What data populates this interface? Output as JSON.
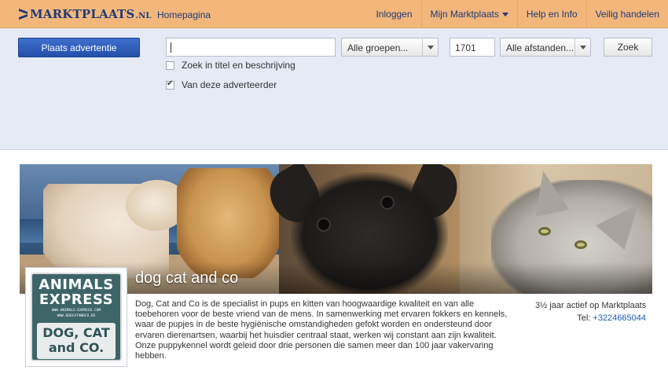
{
  "header": {
    "logo_text": "MARKTPLAATS",
    "logo_suffix": ".NL",
    "home_link": "Homepagina",
    "nav": [
      "Inloggen",
      "Mijn Marktplaats",
      "Help en Info",
      "Veilig handelen"
    ]
  },
  "search": {
    "place_ad": "Plaats advertentie",
    "query_value": "",
    "group_select": "Alle groepen...",
    "zipcode": "1701",
    "distance_select": "Alle afstanden...",
    "search_button": "Zoek",
    "check_title_desc": "Zoek in titel en beschrijving",
    "check_title_desc_checked": false,
    "check_this_advertiser": "Van deze adverteerder",
    "check_this_advertiser_checked": true
  },
  "shop": {
    "name": "dog cat and co",
    "logo_line1": "ANIMALS",
    "logo_line2": "EXPRESS",
    "logo_url1": "WWW.ANIMALS-EXPRESS.COM",
    "logo_url2": "WWW.DOGCATANDCO.BE",
    "logo_line3": "DOG, CAT",
    "logo_line4": "and CO.",
    "description": "Dog, Cat and Co is de specialist in pups en kitten van hoogwaardige kwaliteit en van alle toebehoren voor de beste vriend van de mens. In samenwerking met ervaren fokkers en kennels, waar de pupjes in de beste hygiënische omstandigheden gefokt worden en ondersteund door ervaren dierenartsen, waarbij het huisdier centraal staat, werken wij constant aan zijn kwaliteit. Onze puppykennel wordt geleid door drie personen die samen meer dan 100 jaar vakervaring hebben.",
    "active_since": "3½ jaar actief op Marktplaats",
    "tel_label": "Tel:",
    "tel_number": "+3224665044"
  },
  "colors": {
    "topbar": "#f3b77c",
    "brand_blue": "#1e3a7a",
    "search_bg": "#e5eaf5",
    "button_blue": "#2450a8",
    "link_blue": "#1a5cba"
  }
}
